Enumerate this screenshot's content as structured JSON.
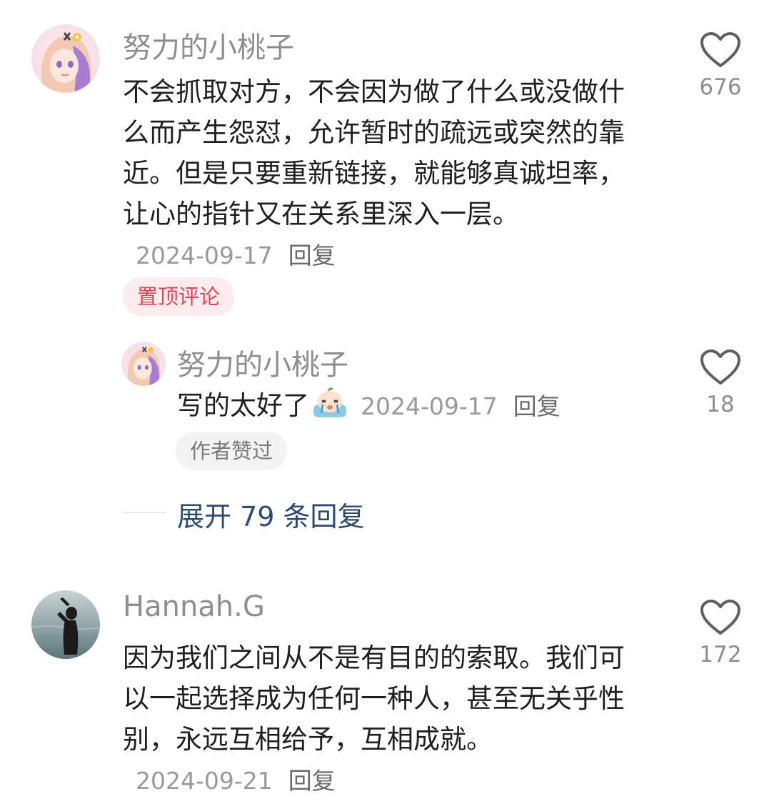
{
  "comments": [
    {
      "username": "努力的小桃子",
      "avatar_icon": "anime-girl-avatar-icon",
      "text": "不会抓取对方，不会因为做了什么或没做什么而产生怨怼，允许暂时的疏远或突然的靠近。但是只要重新链接，就能够真诚坦率，让心的指针又在关系里深入一层。",
      "date": "2024-09-17",
      "reply_label": "回复",
      "badge": "置顶评论",
      "badge_color": "#d9475b",
      "likes": "676",
      "replies": [
        {
          "username": "努力的小桃子",
          "avatar_icon": "anime-girl-avatar-icon",
          "text": "写的太好了",
          "emoji_icon": "crying-emoji-icon",
          "date": "2024-09-17",
          "reply_label": "回复",
          "badge": "作者赞过",
          "likes": "18"
        }
      ],
      "expand_replies_label": "展开 79 条回复"
    },
    {
      "username": "Hannah.G",
      "avatar_icon": "silhouette-photo-avatar-icon",
      "text": "因为我们之间从不是有目的的索取。我们可以一起选择成为任何一种人，甚至无关乎性别，永远互相给予，互相成就。",
      "date": "2024-09-21",
      "reply_label": "回复",
      "likes": "172"
    }
  ],
  "colors": {
    "link": "#2d4a72",
    "meta_gray": "#9a9a9a",
    "heart_stroke": "#5f5f5f"
  },
  "icons": {
    "like": "heart-outline-icon"
  }
}
